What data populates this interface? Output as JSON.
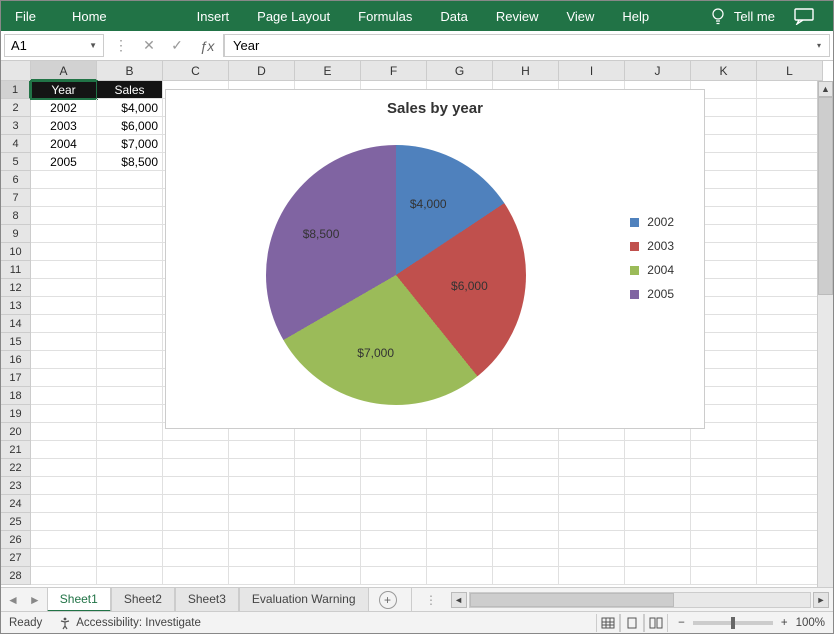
{
  "ribbon": {
    "tabs": [
      "File",
      "Home",
      "Insert",
      "Page Layout",
      "Formulas",
      "Data",
      "Review",
      "View",
      "Help"
    ],
    "tellme": "Tell me"
  },
  "formula_bar": {
    "name_box": "A1",
    "formula": "Year"
  },
  "columns": [
    "A",
    "B",
    "C",
    "D",
    "E",
    "F",
    "G",
    "H",
    "I",
    "J",
    "K",
    "L"
  ],
  "rows_count": 28,
  "selected_cell": "A1",
  "table": {
    "headers": [
      "Year",
      "Sales"
    ],
    "data": [
      {
        "year": "2002",
        "sales": "$4,000"
      },
      {
        "year": "2003",
        "sales": "$6,000"
      },
      {
        "year": "2004",
        "sales": "$7,000"
      },
      {
        "year": "2005",
        "sales": "$8,500"
      }
    ]
  },
  "chart_data": {
    "type": "pie",
    "title": "Sales by year",
    "categories": [
      "2002",
      "2003",
      "2004",
      "2005"
    ],
    "values": [
      4000,
      6000,
      7000,
      8500
    ],
    "labels": [
      "$4,000",
      "$6,000",
      "$7,000",
      "$8,500"
    ],
    "colors": [
      "#4F81BD",
      "#C0504D",
      "#9BBB59",
      "#8064A2"
    ]
  },
  "sheets": [
    "Sheet1",
    "Sheet2",
    "Sheet3",
    "Evaluation Warning"
  ],
  "active_sheet": 0,
  "status": {
    "ready": "Ready",
    "accessibility": "Accessibility: Investigate",
    "zoom": "100%"
  }
}
